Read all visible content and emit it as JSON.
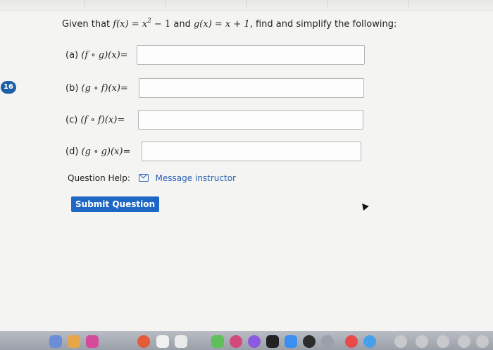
{
  "question_number": "16",
  "prompt": {
    "lead": "Given that ",
    "f_def": "f(x) = x",
    "f_exp": "2",
    "f_rest": " − 1",
    "and": " and ",
    "g_def": "g(x) = x + 1",
    "tail": ", find and simplify the following:"
  },
  "parts": [
    {
      "letter": "(a)",
      "expr": "(f ∘ g)(x)=",
      "value": ""
    },
    {
      "letter": "(b)",
      "expr": "(g ∘ f)(x)=",
      "value": ""
    },
    {
      "letter": "(c)",
      "expr": "(f ∘ f)(x)=",
      "value": ""
    },
    {
      "letter": "(d)",
      "expr": "(g ∘ g)(x)=",
      "value": ""
    }
  ],
  "help": {
    "label": "Question Help:",
    "link": "Message instructor"
  },
  "submit_label": "Submit Question",
  "colors": {
    "badge": "#1f5fa8",
    "button": "#1f67c4",
    "link": "#2a62b8"
  }
}
